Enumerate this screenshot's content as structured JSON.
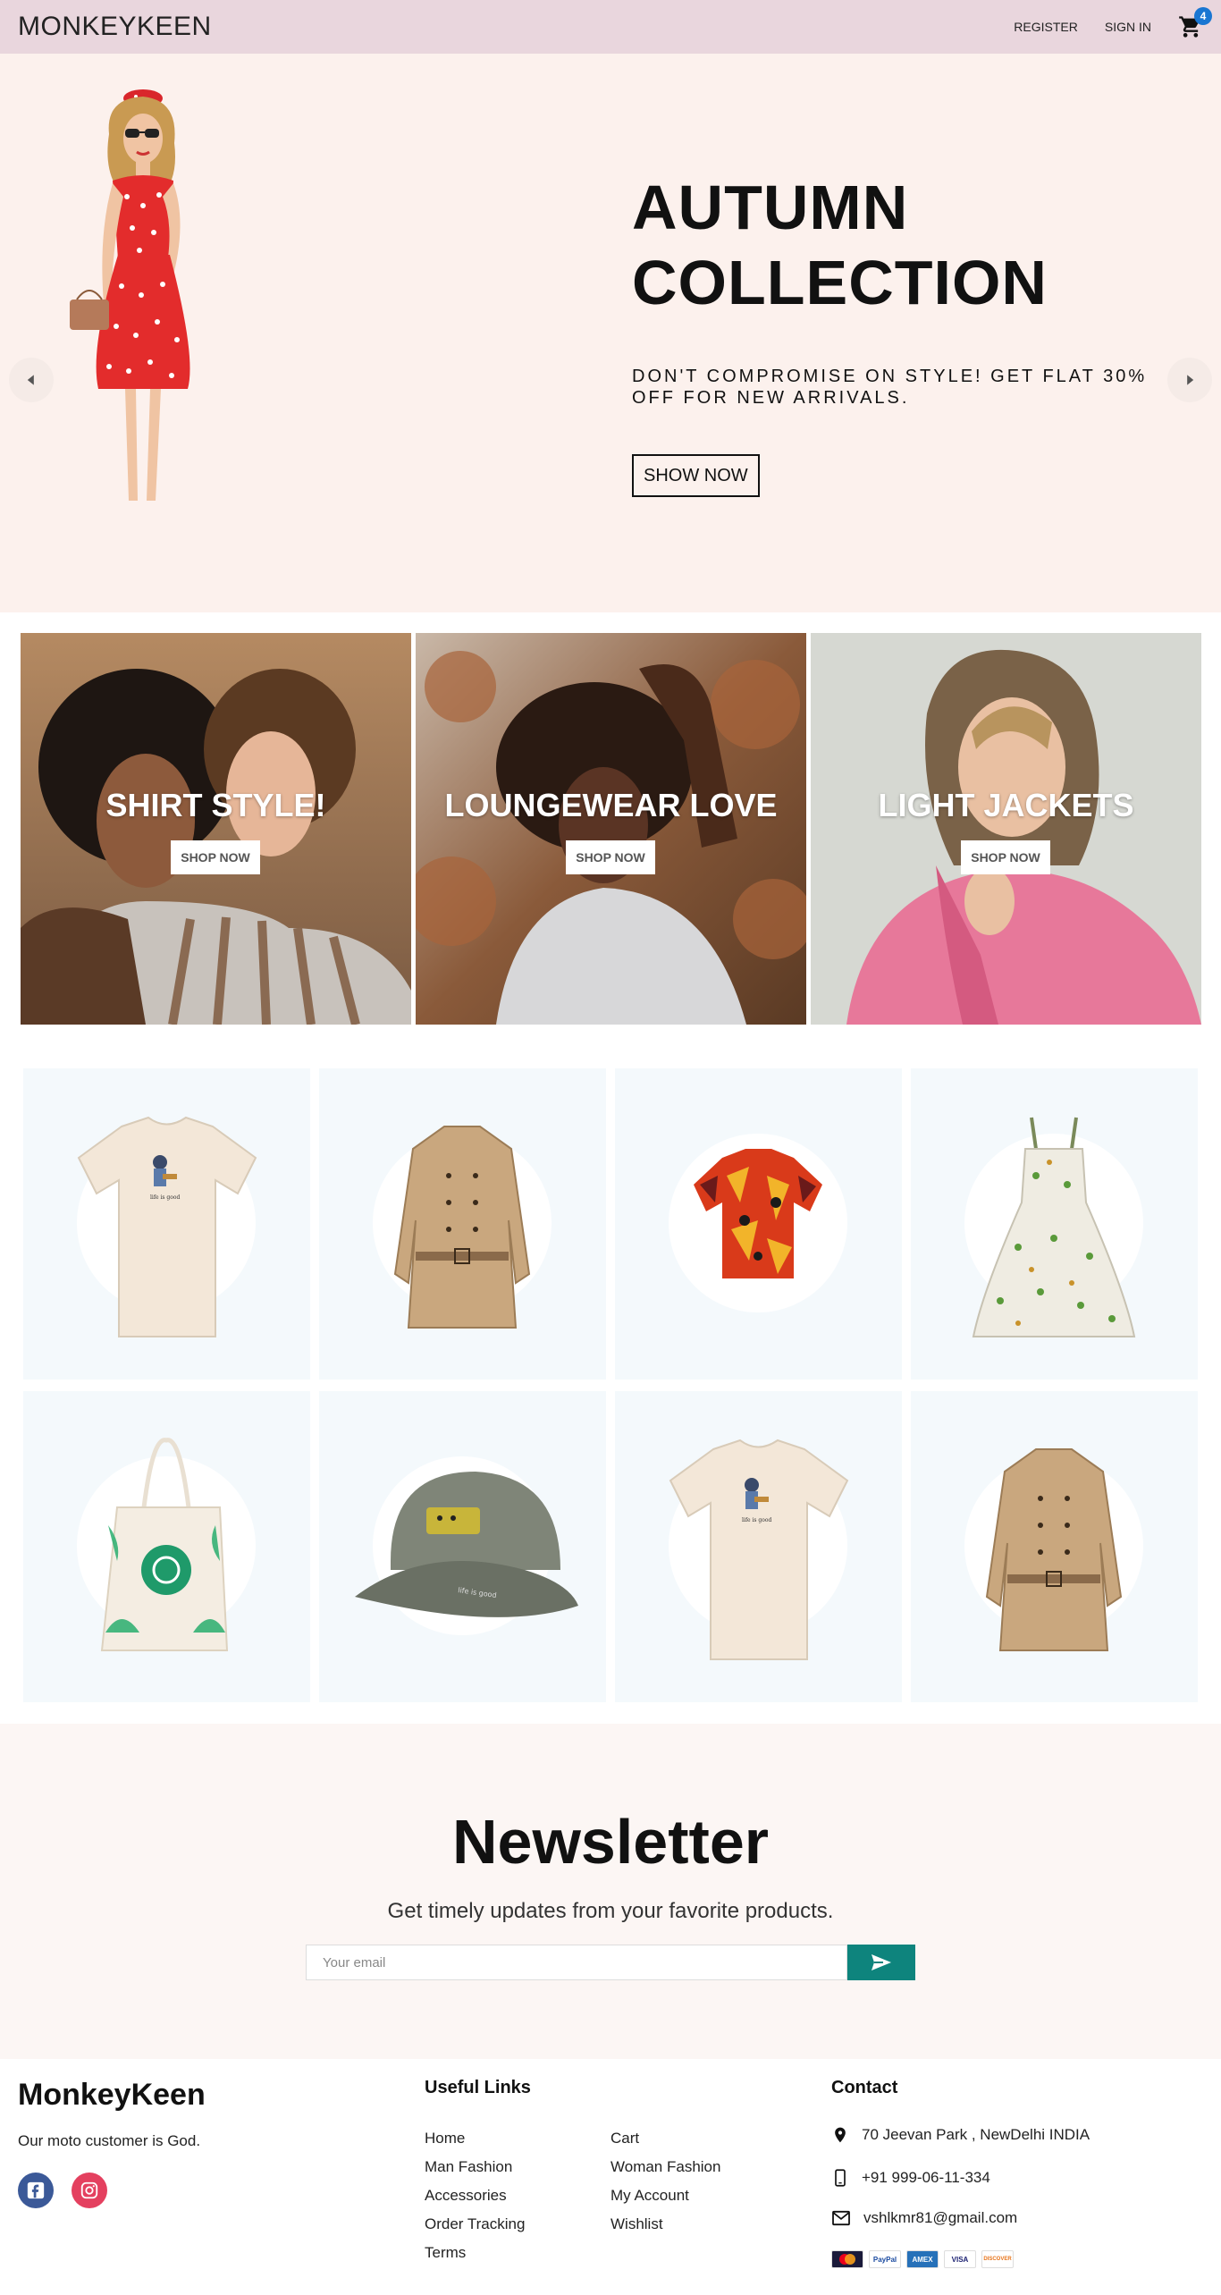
{
  "navbar": {
    "logo": "MONKEYKEEN",
    "register": "REGISTER",
    "sign_in": "SIGN IN",
    "cart_count": "4"
  },
  "hero": {
    "title": "AUTUMN COLLECTION",
    "description": "DON'T COMPROMISE ON STYLE! GET FLAT 30% OFF FOR NEW ARRIVALS.",
    "button": "SHOW NOW"
  },
  "categories": [
    {
      "title": "SHIRT STYLE!",
      "button": "SHOP NOW"
    },
    {
      "title": "LOUNGEWEAR LOVE",
      "button": "SHOP NOW"
    },
    {
      "title": "LIGHT JACKETS",
      "button": "SHOP NOW"
    }
  ],
  "products": [
    {
      "icon": "t-shirt-icon"
    },
    {
      "icon": "trench-coat-icon"
    },
    {
      "icon": "hawaiian-shirt-icon"
    },
    {
      "icon": "dress-icon"
    },
    {
      "icon": "tote-bag-icon"
    },
    {
      "icon": "cap-icon"
    },
    {
      "icon": "t-shirt-icon"
    },
    {
      "icon": "trench-coat-icon"
    }
  ],
  "newsletter": {
    "title": "Newsletter",
    "description": "Get timely updates from your favorite products.",
    "placeholder": "Your email"
  },
  "footer": {
    "brand": "MonkeyKeen",
    "description": "Our moto customer is God.",
    "useful_links_title": "Useful Links",
    "links_col1": [
      "Home",
      "Man Fashion",
      "Accessories",
      "Order Tracking",
      "Terms"
    ],
    "links_col2": [
      "Cart",
      "Woman Fashion",
      "My Account",
      "Wishlist"
    ],
    "contact_title": "Contact",
    "address": "70 Jeevan Park , NewDelhi INDIA",
    "phone": "+91 999-06-11-334",
    "email": "vshlkmr81@gmail.com",
    "payments": [
      "MasterCard",
      "PayPal",
      "AMEX",
      "VISA",
      "DISCOVER"
    ]
  },
  "colors": {
    "navbar_bg": "#e9d6dd",
    "hero_bg": "#fcf1ed",
    "product_bg": "#f4f9fc",
    "newsletter_bg": "#fcf6f4",
    "accent": "#0e847d",
    "badge": "#1976d2"
  }
}
